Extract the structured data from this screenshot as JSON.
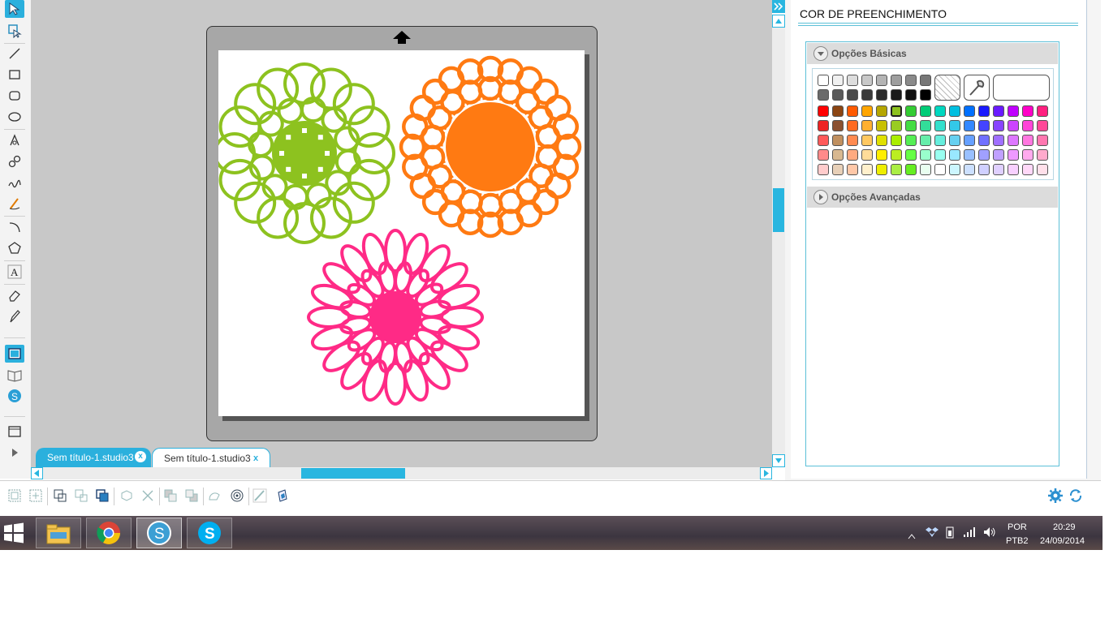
{
  "panel": {
    "title": "COR DE PREENCHIMENTO",
    "basic_options_label": "Opções Básicas",
    "advanced_options_label": "Opções Avançadas"
  },
  "document_tabs": [
    {
      "label": "Sem título-1.studio3",
      "close": "x",
      "active": false
    },
    {
      "label": "Sem título-1.studio3",
      "close": "x",
      "active": true
    }
  ],
  "canvas": {
    "shapes": [
      {
        "name": "green-doily",
        "color": "#8dc21f"
      },
      {
        "name": "orange-doily",
        "color": "#ff7a12"
      },
      {
        "name": "pink-doily",
        "color": "#ff2a86"
      }
    ]
  },
  "palette": {
    "gray_row1": [
      "#ffffff",
      "#f0f0f0",
      "#dddddd",
      "#c8c8c8",
      "#b4b4b4",
      "#9e9e9e",
      "#8a8a8a",
      "#777777"
    ],
    "gray_row2": [
      "#6a6a6a",
      "#5a5a5a",
      "#4a4a4a",
      "#3a3a3a",
      "#2a2a2a",
      "#1a1a1a",
      "#101010",
      "#000000"
    ],
    "rows": [
      [
        "#ff0000",
        "#8b4513",
        "#ff5a00",
        "#ffa500",
        "#b5a600",
        "#8dc21f",
        "#33cc33",
        "#00cc77",
        "#00d8c0",
        "#00bfe0",
        "#0070ff",
        "#1a1aff",
        "#6a1aff",
        "#c000ff",
        "#ff00c8",
        "#ff2080"
      ],
      [
        "#ee2222",
        "#8b5030",
        "#ff6a20",
        "#ffb030",
        "#c8c000",
        "#99cc22",
        "#44dd44",
        "#33dd99",
        "#33e0cc",
        "#33c8e8",
        "#3388ff",
        "#4444ff",
        "#8844ff",
        "#cc44ff",
        "#ff44d8",
        "#ff4898"
      ],
      [
        "#ff5a5a",
        "#c09060",
        "#ff8a50",
        "#ffc860",
        "#e0e000",
        "#aaee00",
        "#55ee55",
        "#66eeaa",
        "#66eedd",
        "#66d0f0",
        "#66a0ff",
        "#7070ff",
        "#a070ff",
        "#dd77ff",
        "#ff77e0",
        "#ff77b0"
      ],
      [
        "#ff8a8a",
        "#d8b890",
        "#ffaa80",
        "#ffdc99",
        "#ffee00",
        "#bbee22",
        "#66ff44",
        "#99ffcc",
        "#99fff0",
        "#99e8ff",
        "#99c0ff",
        "#a0a0ff",
        "#c0a0ff",
        "#ee99ff",
        "#ffaaee",
        "#ffaacc"
      ],
      [
        "#ffcccc",
        "#e8d0b8",
        "#ffc8a8",
        "#fff0cc",
        "#eeee00",
        "#aaee44",
        "#66ee22",
        "#e8fff0",
        "#ffffff",
        "#ccf6ff",
        "#cce0ff",
        "#d0d0ff",
        "#e0d0ff",
        "#f8d0ff",
        "#ffd8f8",
        "#ffe0ea"
      ]
    ],
    "selected": "#8dc21f"
  },
  "taskbar": {
    "apps": [
      "file-explorer",
      "chrome",
      "silhouette-studio",
      "skype"
    ],
    "language": "POR",
    "keyboard": "PTB2",
    "time": "20:29",
    "date": "24/09/2014"
  }
}
